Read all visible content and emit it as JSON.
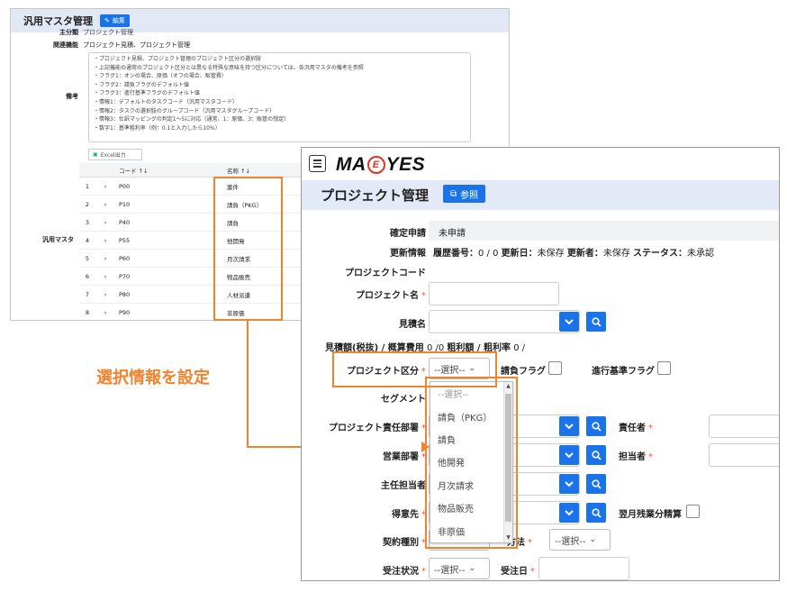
{
  "back_window": {
    "title": "汎用マスタ管理",
    "edit_label": "編集",
    "partial_label": "主分類",
    "partial_value": "プロジェクト管理",
    "related_label": "関連機能",
    "related_value": "プロジェクト見積、プロジェクト管理",
    "notes_label": "備考",
    "notes": [
      "・プロジェクト見積、プロジェクト管理のプロジェクト区分の選択肢",
      "・上記機能の通常のプロジェクト区分とは異なる特殊な意味を持つ区分については、各汎用マスタの備考を参照",
      "・フラグ1：オンの場合、原価（オフの場合、販管費）",
      "・フラグ2：請負フラグのデフォルト値",
      "・フラグ3：進行基準フラグのデフォルト値",
      "・情報1：デフォルトのタスクコード（汎用マスタコード）",
      "・情報2：タスクの選択肢のグループコード（汎用マスタグループコード）",
      "・情報3：仕訳マッピングの判定1～5に対応（通常、1：原価、3：販管の想定）",
      "・数字1：基準粗利率（例：0.1と入力したら10%）"
    ],
    "excel_label": "Excel出力",
    "master_label": "汎用マスタ",
    "columns": [
      "コード ↑↓",
      "名称 ↑↓"
    ],
    "rows": [
      {
        "no": "1",
        "code": "P00",
        "name": "案件"
      },
      {
        "no": "2",
        "code": "P10",
        "name": "請負（PKG）"
      },
      {
        "no": "3",
        "code": "P40",
        "name": "請負"
      },
      {
        "no": "4",
        "code": "P55",
        "name": "他開発"
      },
      {
        "no": "5",
        "code": "P60",
        "name": "月次請求"
      },
      {
        "no": "6",
        "code": "P70",
        "name": "物品販売"
      },
      {
        "no": "7",
        "code": "P80",
        "name": "人材派遣"
      },
      {
        "no": "8",
        "code": "P90",
        "name": "非原価"
      }
    ]
  },
  "front_window": {
    "logo": {
      "left": "MA",
      "mid": "E",
      "right": "YES"
    },
    "title": "プロジェクト管理",
    "ref_label": "参照",
    "confirm_label": "確定申請",
    "confirm_value": "未申請",
    "update_label": "更新情報",
    "update_value_parts": [
      "履歴番号：",
      "0 / 0",
      "更新日：",
      "未保存",
      "更新者：",
      "未保存",
      "ステータス：",
      "未承認"
    ],
    "project_code_label": "プロジェクトコード",
    "project_name_label": "プロジェクト名",
    "estimate_label": "見積名",
    "estimate_amount_text": "見積額(税抜) / 概算費用",
    "estimate_amount_value": "0 /0",
    "gross_text": "粗利額 / 粗利率",
    "gross_value": "0 /",
    "project_type_label": "プロジェクト区分",
    "select_placeholder": "--選択--",
    "contract_flag_label": "請負フラグ",
    "progress_flag_label": "進行基準フラグ",
    "segment_label": "セグメント",
    "dept_label": "プロジェクト責任部署",
    "manager_label": "責任者",
    "sales_dept_label": "営業部署",
    "person_label": "担当者",
    "main_person_label": "主任担当者",
    "client_label": "得意先",
    "next_month_label": "翌月残業分精算",
    "contract_type_label": "契約種別",
    "billing_label": "請求方法",
    "billing_visible": "方法",
    "order_status_label": "受注状況",
    "order_date_label": "受注日",
    "dropdown_options": [
      "--選択--",
      "請負（PKG）",
      "請負",
      "他開発",
      "月次請求",
      "物品販売",
      "非原価"
    ]
  },
  "annotation": {
    "text": "選択情報を設定",
    "color": "#f0832e"
  },
  "colors": {
    "accent": "#1a73e8",
    "header_bg": "#e4e9f7",
    "required": "#e53"
  }
}
